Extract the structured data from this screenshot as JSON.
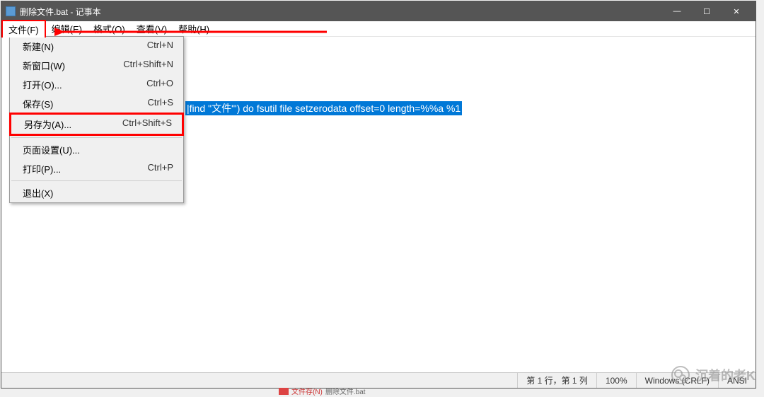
{
  "titlebar": {
    "title": "删除文件.bat - 记事本",
    "minimize": "—",
    "maximize": "☐",
    "close": "✕"
  },
  "menubar": {
    "file": "文件(F)",
    "edit": "编辑(E)",
    "format": "格式(O)",
    "view": "查看(V)",
    "help": "帮助(H)"
  },
  "dropdown": {
    "items": [
      {
        "label": "新建(N)",
        "shortcut": "Ctrl+N"
      },
      {
        "label": "新窗口(W)",
        "shortcut": "Ctrl+Shift+N"
      },
      {
        "label": "打开(O)...",
        "shortcut": "Ctrl+O"
      },
      {
        "label": "保存(S)",
        "shortcut": "Ctrl+S"
      },
      {
        "label": "另存为(A)...",
        "shortcut": "Ctrl+Shift+S"
      },
      {
        "label": "页面设置(U)...",
        "shortcut": ""
      },
      {
        "label": "打印(P)...",
        "shortcut": "Ctrl+P"
      },
      {
        "label": "退出(X)",
        "shortcut": ""
      }
    ]
  },
  "content": {
    "selected_text": "|find \"文件\"') do fsutil file setzerodata offset=0 length=%%a %1"
  },
  "statusbar": {
    "pos": "第 1 行，第 1 列",
    "zoom": "100%",
    "lineend": "Windows (CRLF)",
    "encoding": "ANSI"
  },
  "taskbar": {
    "hint_prefix": "文件存(N)",
    "filename": "删除文件.bat"
  },
  "watermark": {
    "text": "沉着的老K"
  }
}
